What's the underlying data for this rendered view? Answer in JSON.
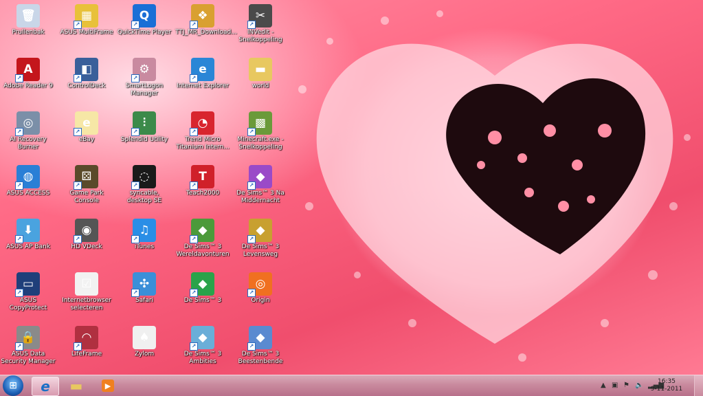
{
  "desktop": {
    "icons": [
      {
        "label": "Prullenbak",
        "icon": "recycle-bin-icon",
        "color": "#c9d6e8",
        "glyph": "🗑",
        "shortcut": false
      },
      {
        "label": "Adobe Reader 9",
        "icon": "adobe-reader-icon",
        "color": "#c4161c",
        "glyph": "A",
        "shortcut": true
      },
      {
        "label": "AI Recovery Burner",
        "icon": "disc-burner-icon",
        "color": "#7b8fa8",
        "glyph": "◎",
        "shortcut": true
      },
      {
        "label": "ASUS ACCESS",
        "icon": "globe-icon",
        "color": "#2a7fd6",
        "glyph": "◍",
        "shortcut": true
      },
      {
        "label": "ASUS AP Bank",
        "icon": "ap-bank-icon",
        "color": "#4aa3df",
        "glyph": "⬇",
        "shortcut": true
      },
      {
        "label": "ASUS CopyProtect",
        "icon": "laptop-icon",
        "color": "#1f3f7a",
        "glyph": "▭",
        "shortcut": true
      },
      {
        "label": "ASUS Data Security Manager",
        "icon": "padlock-icon",
        "color": "#8a8a8a",
        "glyph": "🔒",
        "shortcut": true
      },
      {
        "label": "ASUS MultiFrame",
        "icon": "multiframe-icon",
        "color": "#e8c13a",
        "glyph": "▦",
        "shortcut": true
      },
      {
        "label": "ControlDeck",
        "icon": "control-deck-icon",
        "color": "#3a5f9a",
        "glyph": "◧",
        "shortcut": true
      },
      {
        "label": "eBay",
        "icon": "ebay-icon",
        "color": "#f6e7a6",
        "glyph": "e",
        "shortcut": true
      },
      {
        "label": "Game Park Console",
        "icon": "dice-icon",
        "color": "#5a4a2a",
        "glyph": "⚄",
        "shortcut": true
      },
      {
        "label": "HD VDeck",
        "icon": "speaker-icon",
        "color": "#555555",
        "glyph": "◉",
        "shortcut": true
      },
      {
        "label": "Internetbrowser selecteren",
        "icon": "checklist-icon",
        "color": "#f2f2f2",
        "glyph": "☑",
        "shortcut": false
      },
      {
        "label": "LifeFrame",
        "icon": "lifeframe-icon",
        "color": "#b03040",
        "glyph": "◠",
        "shortcut": true
      },
      {
        "label": "QuickTime Player",
        "icon": "quicktime-icon",
        "color": "#1a6fd6",
        "glyph": "Q",
        "shortcut": true
      },
      {
        "label": "SmartLogon Manager",
        "icon": "smartlogon-icon",
        "color": "#c98aa0",
        "glyph": "⚙",
        "shortcut": true
      },
      {
        "label": "Splendid Utility",
        "icon": "test-tubes-icon",
        "color": "#3c8a4a",
        "glyph": "⫶",
        "shortcut": true
      },
      {
        "label": "syncable, desktop SE",
        "icon": "syncable-icon",
        "color": "#1a1a1a",
        "glyph": "◌",
        "shortcut": true
      },
      {
        "label": "iTunes",
        "icon": "itunes-icon",
        "color": "#2a8ee6",
        "glyph": "♫",
        "shortcut": true
      },
      {
        "label": "Safari",
        "icon": "compass-icon",
        "color": "#3b8fd8",
        "glyph": "✣",
        "shortcut": true
      },
      {
        "label": "Zylom",
        "icon": "cards-icon",
        "color": "#f0f0f0",
        "glyph": "♠",
        "shortcut": false
      },
      {
        "label": "TTJ_MR_Download...",
        "icon": "gift-box-icon",
        "color": "#d9a030",
        "glyph": "❖",
        "shortcut": true
      },
      {
        "label": "Internet Explorer",
        "icon": "internet-explorer-icon",
        "color": "#2a86d6",
        "glyph": "e",
        "shortcut": true
      },
      {
        "label": "Trend Micro Titanium Intern...",
        "icon": "trend-micro-icon",
        "color": "#d8252e",
        "glyph": "◔",
        "shortcut": true
      },
      {
        "label": "Teach2000",
        "icon": "teach2000-icon",
        "color": "#d0202a",
        "glyph": "T",
        "shortcut": true
      },
      {
        "label": "De Sims™ 3 Wereldavonturen",
        "icon": "sims-icon",
        "color": "#4c9a3a",
        "glyph": "◆",
        "shortcut": true
      },
      {
        "label": "De Sims™ 3",
        "icon": "sims-icon",
        "color": "#2aa34a",
        "glyph": "◆",
        "shortcut": true
      },
      {
        "label": "De Sims™ 3 Ambities",
        "icon": "sims-icon",
        "color": "#6aaed8",
        "glyph": "◆",
        "shortcut": true
      },
      {
        "label": "INVedit - Snelkoppeling",
        "icon": "tools-icon",
        "color": "#4a4a4a",
        "glyph": "✂",
        "shortcut": true
      },
      {
        "label": "world",
        "icon": "folder-icon",
        "color": "#e8c860",
        "glyph": "▬",
        "shortcut": false
      },
      {
        "label": "Minecraft.exe - Snelkoppeling",
        "icon": "minecraft-icon",
        "color": "#6a9a3a",
        "glyph": "▩",
        "shortcut": true
      },
      {
        "label": "De Sims™ 3 Na Middernacht",
        "icon": "sims-icon",
        "color": "#9a4ac8",
        "glyph": "◆",
        "shortcut": true
      },
      {
        "label": "De Sims™ 3 Levensweg",
        "icon": "sims-icon",
        "color": "#c8a030",
        "glyph": "◆",
        "shortcut": true
      },
      {
        "label": "Origin",
        "icon": "origin-icon",
        "color": "#f07020",
        "glyph": "◎",
        "shortcut": true
      },
      {
        "label": "De Sims™ 3 Beestenbende",
        "icon": "sims-icon",
        "color": "#5a8ad0",
        "glyph": "◆",
        "shortcut": true
      }
    ]
  },
  "taskbar": {
    "start_icon": "windows-logo-icon",
    "pinned": [
      {
        "name": "internet-explorer",
        "icon": "internet-explorer-icon",
        "glyph": "e",
        "color": "#2a86d6"
      },
      {
        "name": "windows-explorer",
        "icon": "folder-icon",
        "glyph": "▬",
        "color": "#e8c860"
      },
      {
        "name": "media-player",
        "icon": "media-player-icon",
        "glyph": "▶",
        "color": "#f08020"
      }
    ],
    "tray": {
      "show_hidden_icon": "▲",
      "time": "16:35",
      "date": "9-11-2011"
    }
  }
}
